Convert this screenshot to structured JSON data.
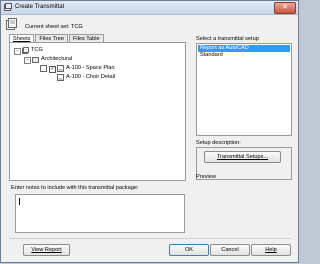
{
  "window": {
    "title": "Create Transmittal",
    "close_glyph": "✕"
  },
  "sheet_set": {
    "label": "Current sheet set:",
    "value": "TCG"
  },
  "tabs": [
    {
      "label": "Sheets"
    },
    {
      "label": "Files Tree"
    },
    {
      "label": "Files Table"
    }
  ],
  "tree": {
    "root": "TCG",
    "group": "Architectural",
    "items": [
      "A-100 - Space Plan",
      "A-100 - Choir Detail"
    ]
  },
  "notes": {
    "label": "Enter notes to include with this transmittal package:",
    "value": ""
  },
  "setup": {
    "label": "Select a transmittal setup",
    "options": [
      "Report as AutoCAD",
      "Standard"
    ],
    "selected": "Report as AutoCAD",
    "description_label": "Setup description:",
    "button_label": "Transmittal Setups..."
  },
  "preview": {
    "label": "Preview"
  },
  "footer": {
    "view_report": "View Report",
    "ok": "OK",
    "cancel": "Cancel",
    "help": "Help"
  },
  "icons": {
    "app": "transmittal-icon",
    "sheet_set": "sheet-set-icon",
    "folder": "sheet-subset-icon",
    "sheet": "sheet-icon"
  },
  "colors": {
    "selection": "#3399ff",
    "title_bar": "#dfe9f5",
    "close_button": "#c8563f"
  }
}
